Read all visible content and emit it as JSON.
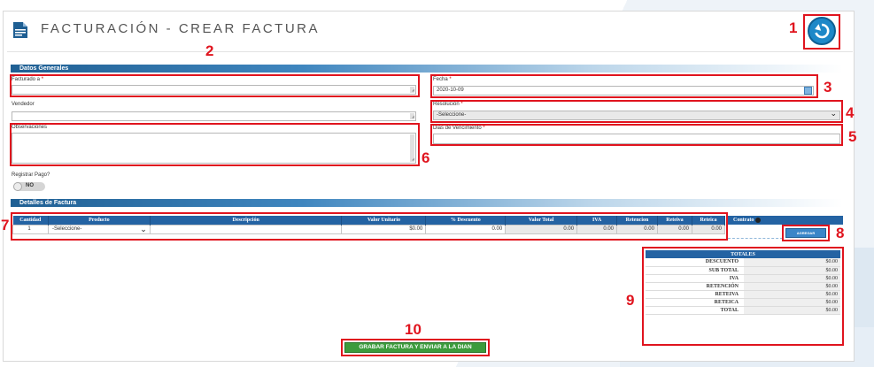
{
  "header": {
    "title": "FACTURACIÓN - CREAR FACTURA"
  },
  "sections": {
    "general": "Datos Generales",
    "details": "Detalles de Factura"
  },
  "fields": {
    "facturado_a": {
      "label": "Facturado a",
      "required": "*",
      "value": ""
    },
    "vendedor": {
      "label": "Vendedor",
      "value": ""
    },
    "observaciones": {
      "label": "Observaciones",
      "value": ""
    },
    "fecha": {
      "label": "Fecha",
      "required": "*",
      "value": "2020-10-09"
    },
    "resolucion": {
      "label": "Resolución",
      "required": "*",
      "value": "-Seleccione-"
    },
    "dias_vencimiento": {
      "label": "Dias de Vencimiento",
      "required": "*",
      "value": ""
    },
    "registrar_pago": {
      "label": "Registrar Pago?",
      "value": "NO"
    }
  },
  "details_table": {
    "columns": [
      "Cantidad",
      "Producto",
      "Descripción",
      "Valor Unitario",
      "% Descuento",
      "Valor Total",
      "IVA",
      "Retencion",
      "Reteiva",
      "Reteica"
    ],
    "row": {
      "cantidad": "1",
      "producto": "-Seleccione-",
      "descripcion": "",
      "valor_unitario": "$0.00",
      "descuento": "0.00",
      "valor_total": "0.00",
      "iva": "0.00",
      "retencion": "0.00",
      "reteiva": "0.00",
      "reteica": "0.00"
    }
  },
  "contrato": {
    "label": "Contrato"
  },
  "buttons": {
    "agregar": "AGREGAR",
    "save": "GRABAR FACTURA Y ENVIAR A LA DIAN"
  },
  "totals": {
    "title": "TOTALES",
    "rows": [
      {
        "label": "DESCUENTO",
        "value": "$0.00"
      },
      {
        "label": "SUB TOTAL",
        "value": "$0.00"
      },
      {
        "label": "IVA",
        "value": "$0.00"
      },
      {
        "label": "RETENCIÓN",
        "value": "$0.00"
      },
      {
        "label": "RETEIVA",
        "value": "$0.00"
      },
      {
        "label": "RETEICA",
        "value": "$0.00"
      },
      {
        "label": "TOTAL",
        "value": "$0.00"
      }
    ]
  },
  "annotations": [
    "1",
    "2",
    "3",
    "4",
    "5",
    "6",
    "7",
    "8",
    "9",
    "10"
  ],
  "colors": {
    "accent": "#2463a3",
    "annotation": "#e0141e",
    "save": "#3c9b3c"
  }
}
